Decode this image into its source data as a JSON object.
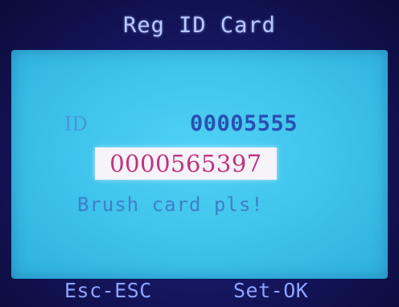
{
  "header": {
    "title": "Reg ID Card"
  },
  "main": {
    "id_label": "ID",
    "id_value": "00005555",
    "card_number": "0000565397",
    "prompt": "Brush card pls!"
  },
  "footer": {
    "esc_label": "Esc-ESC",
    "ok_label": "Set-OK"
  },
  "colors": {
    "screen_bg": "#14155c",
    "panel_bg": "#3ec3ec",
    "title_text": "#b8c8ff",
    "id_value_text": "#2a4fb2",
    "card_number_text": "#c0337e",
    "card_number_bg": "#f6f3f9",
    "prompt_text": "#3f7fc8",
    "footer_text": "#8fa3ff"
  }
}
